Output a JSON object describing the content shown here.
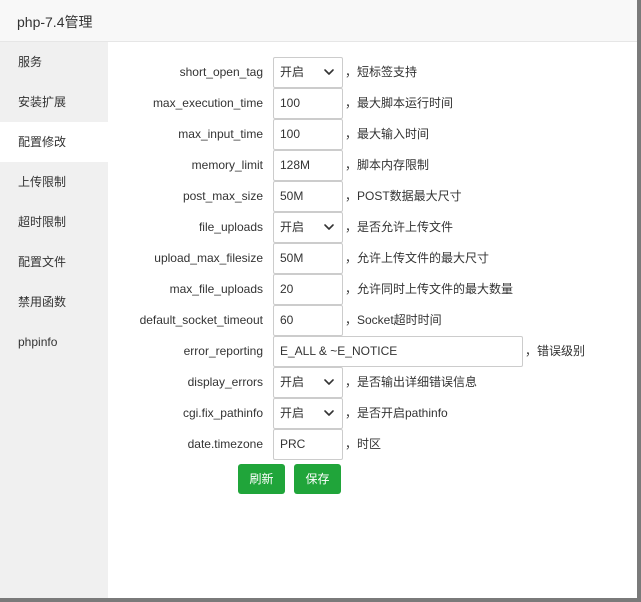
{
  "window": {
    "title": "php-7.4管理"
  },
  "sidebar": {
    "items": [
      {
        "label": "服务"
      },
      {
        "label": "安装扩展"
      },
      {
        "label": "配置修改",
        "active": true
      },
      {
        "label": "上传限制"
      },
      {
        "label": "超时限制"
      },
      {
        "label": "配置文件"
      },
      {
        "label": "禁用函数"
      },
      {
        "label": "phpinfo"
      }
    ]
  },
  "settings": [
    {
      "key": "short_open_tag",
      "control": "select",
      "value": "开启",
      "desc": "，短标签支持"
    },
    {
      "key": "max_execution_time",
      "control": "input",
      "value": "100",
      "desc": "，最大脚本运行时间"
    },
    {
      "key": "max_input_time",
      "control": "input",
      "value": "100",
      "desc": "，最大输入时间"
    },
    {
      "key": "memory_limit",
      "control": "input",
      "value": "128M",
      "desc": "，脚本内存限制"
    },
    {
      "key": "post_max_size",
      "control": "input",
      "value": "50M",
      "desc": "，POST数据最大尺寸"
    },
    {
      "key": "file_uploads",
      "control": "select",
      "value": "开启",
      "desc": "，是否允许上传文件"
    },
    {
      "key": "upload_max_filesize",
      "control": "input",
      "value": "50M",
      "desc": "，允许上传文件的最大尺寸"
    },
    {
      "key": "max_file_uploads",
      "control": "input",
      "value": "20",
      "desc": "，允许同时上传文件的最大数量"
    },
    {
      "key": "default_socket_timeout",
      "control": "input",
      "value": "60",
      "desc": "，Socket超时时间"
    },
    {
      "key": "error_reporting",
      "control": "wide",
      "value": "E_ALL & ~E_NOTICE",
      "desc": "，错误级别"
    },
    {
      "key": "display_errors",
      "control": "select",
      "value": "开启",
      "desc": "，是否输出详细错误信息"
    },
    {
      "key": "cgi.fix_pathinfo",
      "control": "select",
      "value": "开启",
      "desc": "，是否开启pathinfo"
    },
    {
      "key": "date.timezone",
      "control": "input",
      "value": "PRC",
      "desc": "，时区"
    }
  ],
  "buttons": {
    "refresh": "刷新",
    "save": "保存"
  },
  "colors": {
    "accent": "#20a53a",
    "sidebar_bg": "#f0f0f0",
    "title_bg": "#f8f8f8"
  },
  "icons": {
    "select_arrow": "chevron-down-icon",
    "close": "close-icon"
  }
}
